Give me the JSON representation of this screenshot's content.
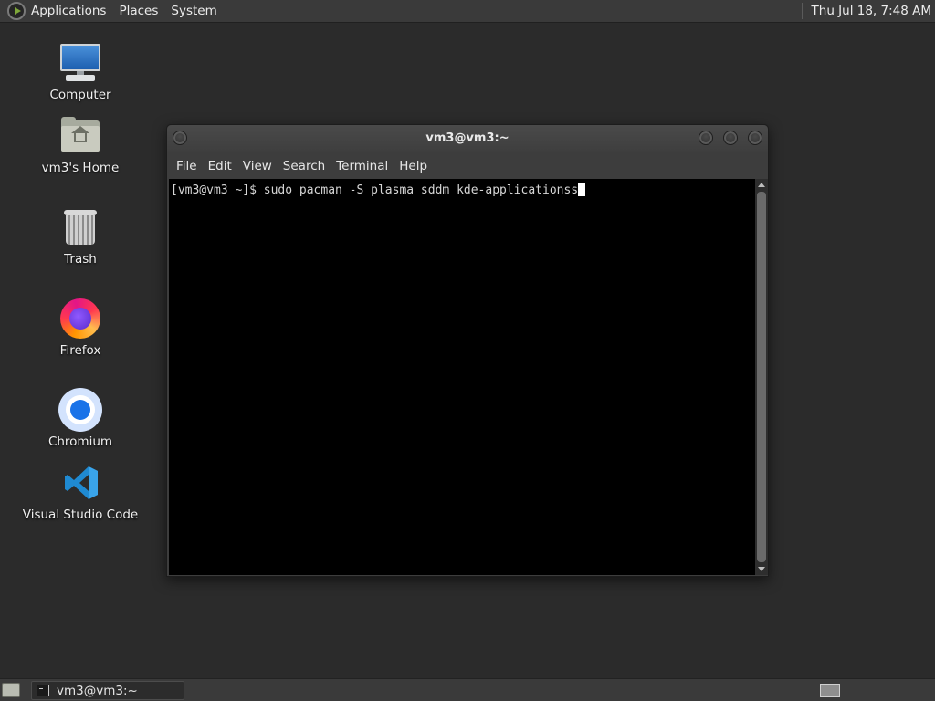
{
  "top_panel": {
    "menus": [
      "Applications",
      "Places",
      "System"
    ],
    "clock": "Thu Jul 18,  7:48 AM"
  },
  "desktop": {
    "icons": [
      {
        "label": "Computer",
        "icon": "computer-icon"
      },
      {
        "label": "vm3's Home",
        "icon": "home-folder-icon"
      },
      {
        "label": "Trash",
        "icon": "trash-icon"
      },
      {
        "label": "Firefox",
        "icon": "firefox-icon"
      },
      {
        "label": "Chromium",
        "icon": "chromium-icon"
      },
      {
        "label": "Visual Studio Code",
        "icon": "vscode-icon"
      }
    ]
  },
  "terminal": {
    "title": "vm3@vm3:~",
    "menu": [
      "File",
      "Edit",
      "View",
      "Search",
      "Terminal",
      "Help"
    ],
    "prompt": "[vm3@vm3 ~]$ ",
    "command": "sudo pacman -S plasma sddm kde-applicationss"
  },
  "bottom_panel": {
    "task_label": "vm3@vm3:~"
  },
  "colors": {
    "desktop_bg": "#2b2b2b",
    "panel_bg": "#3a3a3a",
    "terminal_bg": "#000000",
    "terminal_fg": "#d6d6d6"
  }
}
